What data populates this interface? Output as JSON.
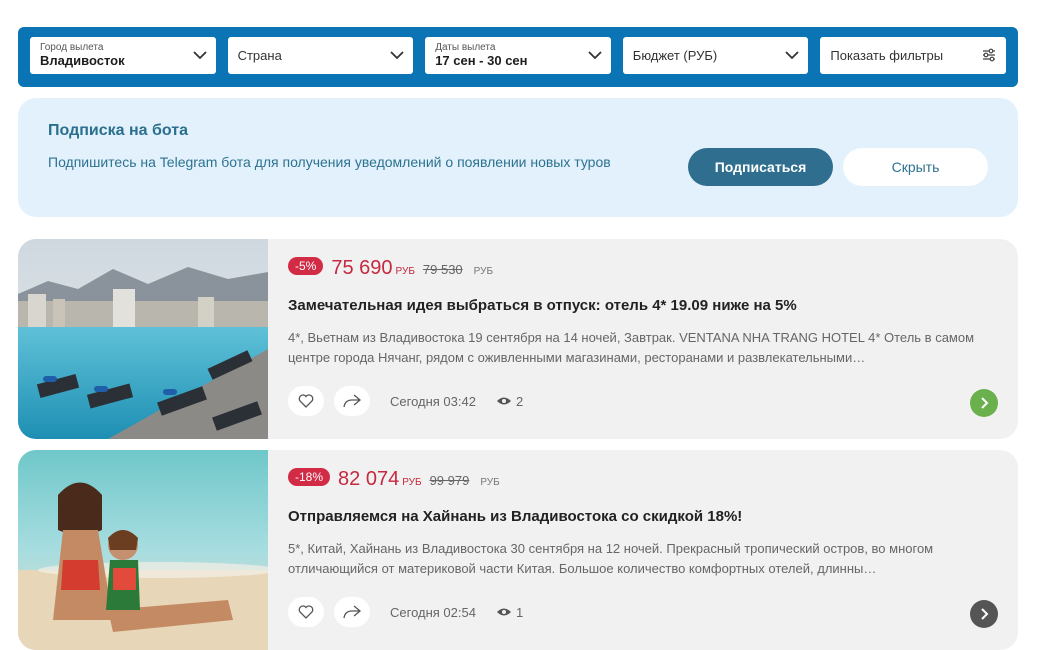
{
  "filters": {
    "city": {
      "label": "Город вылета",
      "value": "Владивосток"
    },
    "country": {
      "placeholder": "Страна"
    },
    "dates": {
      "label": "Даты вылета",
      "value": "17 сен - 30 сен"
    },
    "budget": {
      "placeholder": "Бюджет (РУБ)"
    },
    "more": {
      "label": "Показать фильтры"
    }
  },
  "banner": {
    "title": "Подписка на бота",
    "text": "Подпишитесь на Telegram бота для получения уведомлений о появлении новых туров",
    "subscribe_label": "Подписаться",
    "hide_label": "Скрыть"
  },
  "tours": [
    {
      "discount": "-5%",
      "price": "75 690",
      "currency": "РУБ",
      "old_price": "79 530",
      "old_currency": "РУБ",
      "title": "Замечательная идея выбраться в отпуск: отель 4* 19.09 ниже на 5%",
      "description": "4*, Вьетнам из Владивостока 19 сентября на 14 ночей, Завтрак. VENTANA NHA TRANG HOTEL 4* Отель в самом центре города Нячанг, рядом с оживленными магазинами, ресторанами и развлекательными…",
      "date": "Сегодня 03:42",
      "views": "2",
      "go_color": "#6ab04c"
    },
    {
      "discount": "-18%",
      "price": "82 074",
      "currency": "РУБ",
      "old_price": "99 979",
      "old_currency": "РУБ",
      "title": "Отправляемся на Хайнань из Владивостока со скидкой 18%!",
      "description": "5*, Китай, Хайнань из Владивостока 30 сентября на 12 ночей. Прекрасный тропический остров, во многом отличающийся от материковой части Китая. Большое количество комфортных отелей, длинны…",
      "date": "Сегодня 02:54",
      "views": "1",
      "go_color": "#555555"
    }
  ]
}
